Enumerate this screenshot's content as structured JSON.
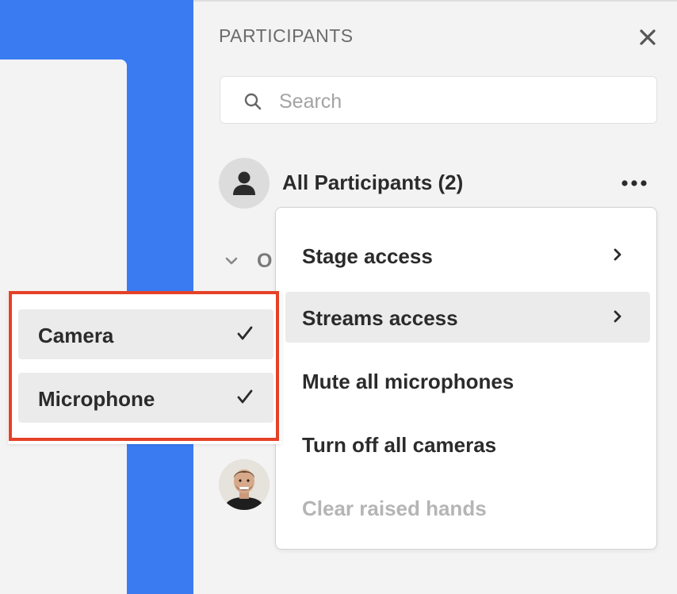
{
  "panel": {
    "title": "PARTICIPANTS",
    "close_icon": "close-icon"
  },
  "search": {
    "placeholder": "Search",
    "value": "",
    "icon": "search-icon"
  },
  "all_participants": {
    "label": "All Participants (2)",
    "avatar_icon": "person-icon",
    "more_icon": "more-horizontal-icon"
  },
  "section": {
    "visible_label": "O",
    "icon": "chevron-down-icon"
  },
  "menu": {
    "items": [
      {
        "label": "Stage access",
        "has_submenu": true,
        "active": false,
        "disabled": false
      },
      {
        "label": "Streams access",
        "has_submenu": true,
        "active": true,
        "disabled": false
      },
      {
        "label": "Mute all microphones",
        "has_submenu": false,
        "active": false,
        "disabled": false
      },
      {
        "label": "Turn off all cameras",
        "has_submenu": false,
        "active": false,
        "disabled": false
      },
      {
        "label": "Clear raised hands",
        "has_submenu": false,
        "active": false,
        "disabled": true
      }
    ]
  },
  "submenu": {
    "items": [
      {
        "label": "Camera",
        "checked": true
      },
      {
        "label": "Microphone",
        "checked": true
      }
    ]
  },
  "colors": {
    "stage_blue": "#3a7bf2",
    "annotation_red": "#e54127",
    "panel_bg": "#f3f3f3",
    "menu_active": "#ebebeb",
    "disabled_text": "#b5b5b5"
  }
}
